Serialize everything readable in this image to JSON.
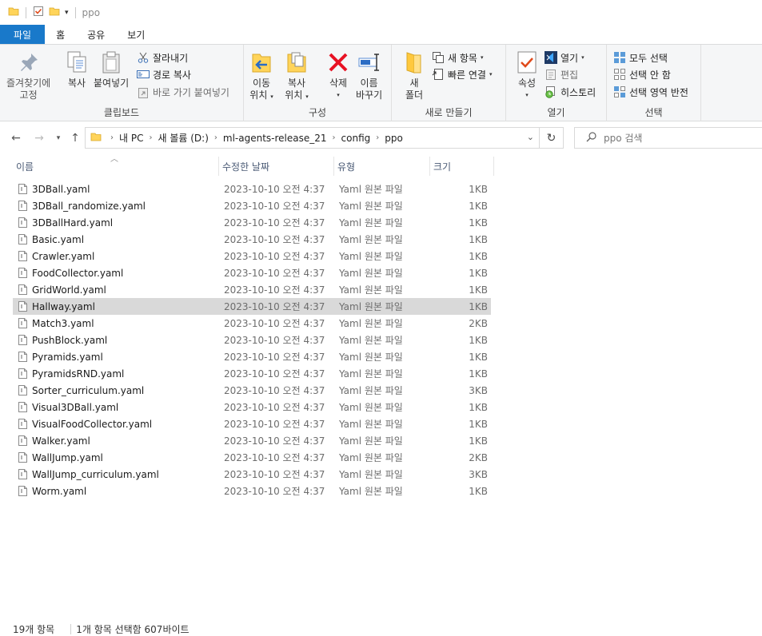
{
  "window": {
    "title": "ppo"
  },
  "ribbon_tabs": [
    "파일",
    "홈",
    "공유",
    "보기"
  ],
  "clipboard": {
    "pin": [
      "즐겨찾기에",
      "고정"
    ],
    "copy": "복사",
    "paste": "붙여넣기",
    "cut": "잘라내기",
    "copy_path": "경로 복사",
    "paste_shortcut": "바로 가기 붙여넣기",
    "label": "클립보드"
  },
  "organize": {
    "move": [
      "이동",
      "위치"
    ],
    "copyto": [
      "복사",
      "위치"
    ],
    "delete": "삭제",
    "rename": [
      "이름",
      "바꾸기"
    ],
    "label": "구성"
  },
  "new": {
    "folder": [
      "새",
      "폴더"
    ],
    "new_item": "새 항목",
    "easy_access": "빠른 연결",
    "label": "새로 만들기"
  },
  "open": {
    "properties": "속성",
    "open": "열기",
    "edit": "편집",
    "history": "히스토리",
    "label": "열기"
  },
  "select": {
    "all": "모두 선택",
    "none": "선택 안 함",
    "invert": "선택 영역 반전",
    "label": "선택"
  },
  "address": {
    "crumbs": [
      "내 PC",
      "새 볼륨 (D:)",
      "ml-agents-release_21",
      "config",
      "ppo"
    ],
    "search_placeholder": "ppo 검색"
  },
  "columns": {
    "name": "이름",
    "date": "수정한 날짜",
    "type": "유형",
    "size": "크기"
  },
  "files": [
    {
      "name": "3DBall.yaml",
      "date": "2023-10-10 오전 4:37",
      "type": "Yaml 원본 파일",
      "size": "1KB"
    },
    {
      "name": "3DBall_randomize.yaml",
      "date": "2023-10-10 오전 4:37",
      "type": "Yaml 원본 파일",
      "size": "1KB"
    },
    {
      "name": "3DBallHard.yaml",
      "date": "2023-10-10 오전 4:37",
      "type": "Yaml 원본 파일",
      "size": "1KB"
    },
    {
      "name": "Basic.yaml",
      "date": "2023-10-10 오전 4:37",
      "type": "Yaml 원본 파일",
      "size": "1KB"
    },
    {
      "name": "Crawler.yaml",
      "date": "2023-10-10 오전 4:37",
      "type": "Yaml 원본 파일",
      "size": "1KB"
    },
    {
      "name": "FoodCollector.yaml",
      "date": "2023-10-10 오전 4:37",
      "type": "Yaml 원본 파일",
      "size": "1KB"
    },
    {
      "name": "GridWorld.yaml",
      "date": "2023-10-10 오전 4:37",
      "type": "Yaml 원본 파일",
      "size": "1KB"
    },
    {
      "name": "Hallway.yaml",
      "date": "2023-10-10 오전 4:37",
      "type": "Yaml 원본 파일",
      "size": "1KB",
      "selected": true
    },
    {
      "name": "Match3.yaml",
      "date": "2023-10-10 오전 4:37",
      "type": "Yaml 원본 파일",
      "size": "2KB"
    },
    {
      "name": "PushBlock.yaml",
      "date": "2023-10-10 오전 4:37",
      "type": "Yaml 원본 파일",
      "size": "1KB"
    },
    {
      "name": "Pyramids.yaml",
      "date": "2023-10-10 오전 4:37",
      "type": "Yaml 원본 파일",
      "size": "1KB"
    },
    {
      "name": "PyramidsRND.yaml",
      "date": "2023-10-10 오전 4:37",
      "type": "Yaml 원본 파일",
      "size": "1KB"
    },
    {
      "name": "Sorter_curriculum.yaml",
      "date": "2023-10-10 오전 4:37",
      "type": "Yaml 원본 파일",
      "size": "3KB"
    },
    {
      "name": "Visual3DBall.yaml",
      "date": "2023-10-10 오전 4:37",
      "type": "Yaml 원본 파일",
      "size": "1KB"
    },
    {
      "name": "VisualFoodCollector.yaml",
      "date": "2023-10-10 오전 4:37",
      "type": "Yaml 원본 파일",
      "size": "1KB"
    },
    {
      "name": "Walker.yaml",
      "date": "2023-10-10 오전 4:37",
      "type": "Yaml 원본 파일",
      "size": "1KB"
    },
    {
      "name": "WallJump.yaml",
      "date": "2023-10-10 오전 4:37",
      "type": "Yaml 원본 파일",
      "size": "2KB"
    },
    {
      "name": "WallJump_curriculum.yaml",
      "date": "2023-10-10 오전 4:37",
      "type": "Yaml 원본 파일",
      "size": "3KB"
    },
    {
      "name": "Worm.yaml",
      "date": "2023-10-10 오전 4:37",
      "type": "Yaml 원본 파일",
      "size": "1KB"
    }
  ],
  "status": {
    "count": "19개 항목",
    "selection": "1개 항목 선택함 607바이트"
  },
  "colors": {
    "accent": "#1979ca",
    "selected_row": "#d9d9d9",
    "folder": "#ffd45a",
    "delete_red": "#e81123"
  }
}
